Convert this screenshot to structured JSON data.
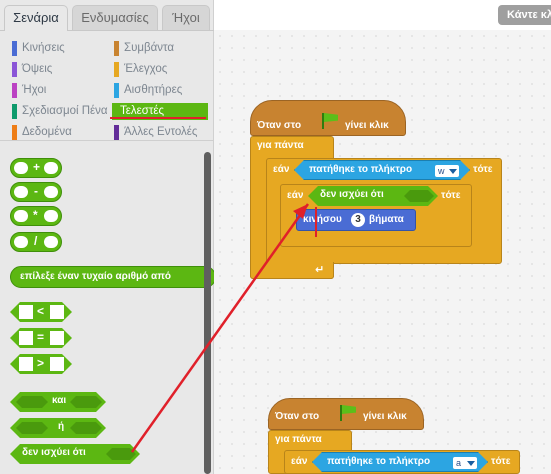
{
  "tabs": [
    "Σενάρια",
    "Ενδυμασίες",
    "Ήχοι"
  ],
  "categories": [
    {
      "label": "Κινήσεις",
      "color": "#4a6cd4"
    },
    {
      "label": "Συμβάντα",
      "color": "#c88330"
    },
    {
      "label": "Όψεις",
      "color": "#8a55d7"
    },
    {
      "label": "Έλεγχος",
      "color": "#e6a822"
    },
    {
      "label": "Ήχοι",
      "color": "#bb42c3"
    },
    {
      "label": "Αισθητήρες",
      "color": "#2ca5e2"
    },
    {
      "label": "Σχεδιασμοί Πένα",
      "color": "#0e9a6c"
    },
    {
      "label": "Τελεστές",
      "color": "#5cb712"
    },
    {
      "label": "Δεδομένα",
      "color": "#ee7d16"
    },
    {
      "label": "Άλλες Εντολές",
      "color": "#632d99"
    }
  ],
  "palette": {
    "ops": [
      "+",
      "-",
      "*",
      "/"
    ],
    "random": "επίλεξε έναν τυχαίο αριθμό από",
    "compare": [
      "<",
      "=",
      ">"
    ],
    "and": "και",
    "or": "ή",
    "not": "δεν ισχύει ότι"
  },
  "presentation_button": "Κάντε κλικ",
  "script1": {
    "hat": "Όταν στο",
    "hat_suffix": "γίνει κλικ",
    "forever": "για πάντα",
    "if1": "εάν",
    "key_pressed": "πατήθηκε το πλήκτρο",
    "key1": "w",
    "then": "τότε",
    "if2": "εάν",
    "not": "δεν ισχύει ότι",
    "move_prefix": "κινήσου",
    "move_steps": "3",
    "move_suffix": "βήματα"
  },
  "script2": {
    "hat": "Όταν στο",
    "hat_suffix": "γίνει κλικ",
    "forever": "για πάντα",
    "if1": "εάν",
    "key_pressed": "πατήθηκε το πλήκτρο",
    "key1": "a",
    "then": "τότε"
  }
}
